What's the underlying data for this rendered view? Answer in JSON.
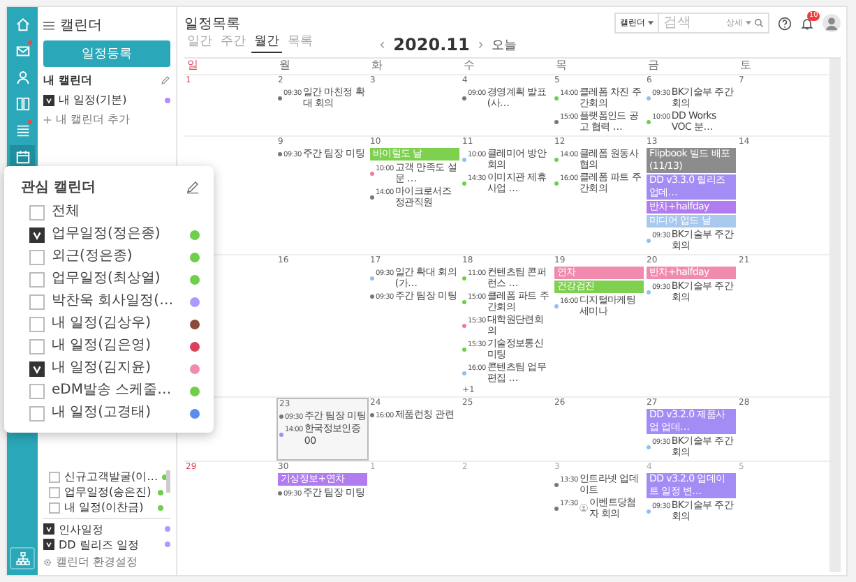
{
  "rail": {
    "items": [
      {
        "kind": "home",
        "selected": false,
        "badge": false
      },
      {
        "kind": "mail",
        "selected": false,
        "badge": true
      },
      {
        "kind": "person",
        "selected": false,
        "badge": false
      },
      {
        "kind": "grid",
        "selected": false,
        "badge": false
      },
      {
        "kind": "list",
        "selected": false,
        "badge": true
      },
      {
        "kind": "calendar",
        "selected": true,
        "badge": false
      }
    ],
    "bottom_items": [
      {
        "kind": "org",
        "selected": false,
        "badge": false
      }
    ]
  },
  "sidebar": {
    "title": "캘린더",
    "primary_button": "일정등록",
    "my_calendars": {
      "heading": "내 캘린더",
      "items": [
        {
          "label": "내 일정(기본)",
          "checked": true,
          "color": "#b28cff"
        }
      ],
      "add_link": "내 캘린더 추가"
    },
    "lower_items": [
      {
        "label": "신규고객발굴(이…",
        "checked": false,
        "color": "#6fcf4a"
      },
      {
        "label": "업무일정(송은진)",
        "checked": false,
        "color": "#6fcf4a"
      },
      {
        "label": "내 일정(이찬금)",
        "checked": false,
        "color": "#6fcf4a"
      }
    ],
    "shared_items": [
      {
        "label": "인사일정",
        "checked": true,
        "color": "#a99cff"
      },
      {
        "label": "DD 릴리즈 일정",
        "checked": true,
        "color": "#a99cff"
      }
    ],
    "settings_link": "캘린더 환경설정"
  },
  "header": {
    "title": "일정목록",
    "view_tabs": [
      {
        "label": "일간",
        "selected": false
      },
      {
        "label": "주간",
        "selected": false
      },
      {
        "label": "월간",
        "selected": true
      },
      {
        "label": "목록",
        "selected": false
      }
    ],
    "prev": "‹",
    "month": "2020.11",
    "next": "›",
    "today_button": "오늘",
    "search": {
      "scope": "캘린더",
      "placeholder": "검색",
      "detail": "상세"
    },
    "notification_count": "10"
  },
  "calendar": {
    "weekdays": [
      {
        "label": "일",
        "holiday": true
      },
      {
        "label": "월",
        "holiday": false
      },
      {
        "label": "화",
        "holiday": false
      },
      {
        "label": "수",
        "holiday": false
      },
      {
        "label": "목",
        "holiday": false
      },
      {
        "label": "금",
        "holiday": false
      },
      {
        "label": "토",
        "holiday": false
      }
    ],
    "weeks": [
      {
        "days": [
          {
            "date": "1",
            "holiday": true
          },
          {
            "date": "2",
            "events": [
              {
                "time": "09:30",
                "text": "일간 마친정 확대 회의",
                "color": "#777777"
              }
            ]
          },
          {
            "date": "3"
          },
          {
            "date": "4",
            "events": [
              {
                "time": "09:00",
                "text": "경영계획 발표 (사…",
                "color": "#777777"
              }
            ]
          },
          {
            "date": "5",
            "events": [
              {
                "time": "14:00",
                "text": "클레폼 차진 주간회의",
                "color": "#6fcf4a"
              },
              {
                "time": "15:00",
                "text": "플랫폼인드 공고 협력 …",
                "color": "#777777"
              }
            ]
          },
          {
            "date": "6",
            "events": [
              {
                "time": "09:30",
                "text": "BK기술부 주간회의",
                "color": "#8fc1f0"
              },
              {
                "time": "10:00",
                "text": "DD Works VOC 분…",
                "color": "#6fcf4a"
              }
            ]
          },
          {
            "date": "7"
          }
        ]
      },
      {
        "days": [
          {
            "date": "9",
            "events": [
              {
                "time": "09:30",
                "text": "주간 팀장 미팅",
                "color": "#777777"
              }
            ]
          },
          {
            "date": "10",
            "bars": [
              {
                "text": "바이럴도 날",
                "color": "#7ed04f"
              }
            ],
            "events": [
              {
                "time": "10:00",
                "text": "고객 만족도 설문 …",
                "color": "#f07aa0"
              },
              {
                "time": "14:00",
                "text": "마이크로서즈 정관직원",
                "color": "#777777"
              }
            ]
          },
          {
            "date": "11",
            "events": [
              {
                "time": "10:00",
                "text": "클레미어 방안회의",
                "color": "#8fc1f0"
              },
              {
                "time": "14:30",
                "text": "이미지관 제휴사업 …",
                "color": "#6fcf4a"
              }
            ]
          },
          {
            "date": "12",
            "events": [
              {
                "time": "14:00",
                "text": "클레폼 원동사 협의",
                "color": "#6fcf4a"
              },
              {
                "time": "16:00",
                "text": "클레폼 파트 주간회의",
                "color": "#6fcf4a"
              }
            ]
          },
          {
            "date": "13",
            "bars": [
              {
                "text": "Flipbook 빌드 배포 (11/13)",
                "color": "#8c8c8c"
              },
              {
                "text": "DD v3.3.0 릴리즈 업데…",
                "color": "#a48cf5"
              },
              {
                "text": "반차+halfday",
                "color": "#b07cf0"
              },
              {
                "text": "미디어 업드 날",
                "color": "#a9c8ee"
              }
            ],
            "events": [
              {
                "time": "09:30",
                "text": "BK기술부 주간회의",
                "color": "#8fc1f0"
              }
            ]
          },
          {
            "date": "14"
          }
        ]
      },
      {
        "days": [
          {
            "date": "16"
          },
          {
            "date": "17",
            "events": [
              {
                "time": "09:30",
                "text": "일간 확대 회의(가…",
                "color": "#8fc1f0"
              },
              {
                "time": "09:30",
                "text": "주간 팀장 미팅",
                "color": "#777777"
              }
            ]
          },
          {
            "date": "18",
            "events": [
              {
                "time": "11:00",
                "text": "컨텐츠팀 콘퍼런스 …",
                "color": "#6fcf4a"
              },
              {
                "time": "15:00",
                "text": "클레폼 파트 주간회의",
                "color": "#6fcf4a"
              },
              {
                "time": "15:30",
                "text": "대학원단련회의",
                "color": "#f07aa0"
              },
              {
                "time": "15:30",
                "text": "기술정보통신 미팅",
                "color": "#6fcf4a"
              },
              {
                "time": "16:00",
                "text": "콘텐츠팀 업무편집 …",
                "color": "#8fc1f0"
              }
            ],
            "more": "+1"
          },
          {
            "date": "19",
            "bars": [
              {
                "text": "연차",
                "color": "#f08aae"
              },
              {
                "text": "건강검진",
                "color": "#7ed04f"
              }
            ],
            "events": [
              {
                "time": "16:00",
                "text": "디지털마케팅 세미나",
                "color": "#8fc1f0"
              }
            ]
          },
          {
            "date": "20",
            "bars": [
              {
                "text": "반차+halfday",
                "color": "#f08aae"
              }
            ],
            "events": [
              {
                "time": "09:30",
                "text": "BK기술부 주간회의",
                "color": "#8fc1f0"
              }
            ]
          },
          {
            "date": "21"
          }
        ]
      },
      {
        "days": [
          {
            "date": "23",
            "today": true,
            "events": [
              {
                "time": "09:30",
                "text": "주간 팀장 미팅",
                "color": "#777777"
              },
              {
                "time": "14:00",
                "text": "한국정보인증 00",
                "color": "#a48cf5"
              }
            ]
          },
          {
            "date": "24",
            "events": [
              {
                "time": "16:00",
                "text": "제품런칭 관련",
                "color": "#777777"
              }
            ]
          },
          {
            "date": "25"
          },
          {
            "date": "26"
          },
          {
            "date": "27",
            "bars": [
              {
                "text": "DD v3.2.0 제품사업 업데…",
                "color": "#a48cf5"
              }
            ],
            "events": [
              {
                "time": "09:30",
                "text": "BK기술부 주간회의",
                "color": "#8fc1f0"
              }
            ]
          },
          {
            "date": "28"
          }
        ]
      },
      {
        "days": [
          {
            "date": "29",
            "holiday": true
          },
          {
            "date": "30",
            "bars": [
              {
                "text": "기상정보+연차",
                "color": "#b07cf0"
              }
            ],
            "events": [
              {
                "time": "09:30",
                "text": "주간 팀장 미팅",
                "color": "#777777"
              }
            ]
          },
          {
            "date": "1",
            "other_month": true
          },
          {
            "date": "2",
            "other_month": true
          },
          {
            "date": "3",
            "other_month": true,
            "events": [
              {
                "time": "13:30",
                "text": "인트라넷 업데이트",
                "color": "#777777"
              },
              {
                "time": "17:30",
                "text": "이벤트당첨자 회의",
                "color": "#777777",
                "attendee_icon": true
              }
            ]
          },
          {
            "date": "4",
            "other_month": true,
            "bars": [
              {
                "text": "DD v3.2.0 업데이트 일정 변…",
                "color": "#a48cf5"
              }
            ],
            "events": [
              {
                "time": "09:30",
                "text": "BK기술부 주간회의",
                "color": "#8fc1f0"
              }
            ]
          },
          {
            "date": "5",
            "other_month": true
          }
        ]
      }
    ]
  },
  "popup": {
    "title": "관심 캘린더",
    "items": [
      {
        "label": "전체",
        "checked": false
      },
      {
        "label": "업무일정(정은종)",
        "checked": true,
        "color": "#6fcf4a"
      },
      {
        "label": "외근(정은종)",
        "checked": false,
        "color": "#6fcf4a"
      },
      {
        "label": "업무일정(최상열)",
        "checked": false,
        "color": "#6fcf4a"
      },
      {
        "label": "박찬욱 회사일정(…",
        "checked": false,
        "color": "#a99cff"
      },
      {
        "label": "내 일정(김상우)",
        "checked": false,
        "color": "#8b4a3a"
      },
      {
        "label": "내 일정(김은영)",
        "checked": false,
        "color": "#d9415a"
      },
      {
        "label": "내 일정(김지윤)",
        "checked": true,
        "color": "#f08cb0"
      },
      {
        "label": "eDM발송 스케줄…",
        "checked": false,
        "color": "#6fcf4a"
      },
      {
        "label": "내 일정(고경태)",
        "checked": false,
        "color": "#5b8def"
      }
    ]
  }
}
